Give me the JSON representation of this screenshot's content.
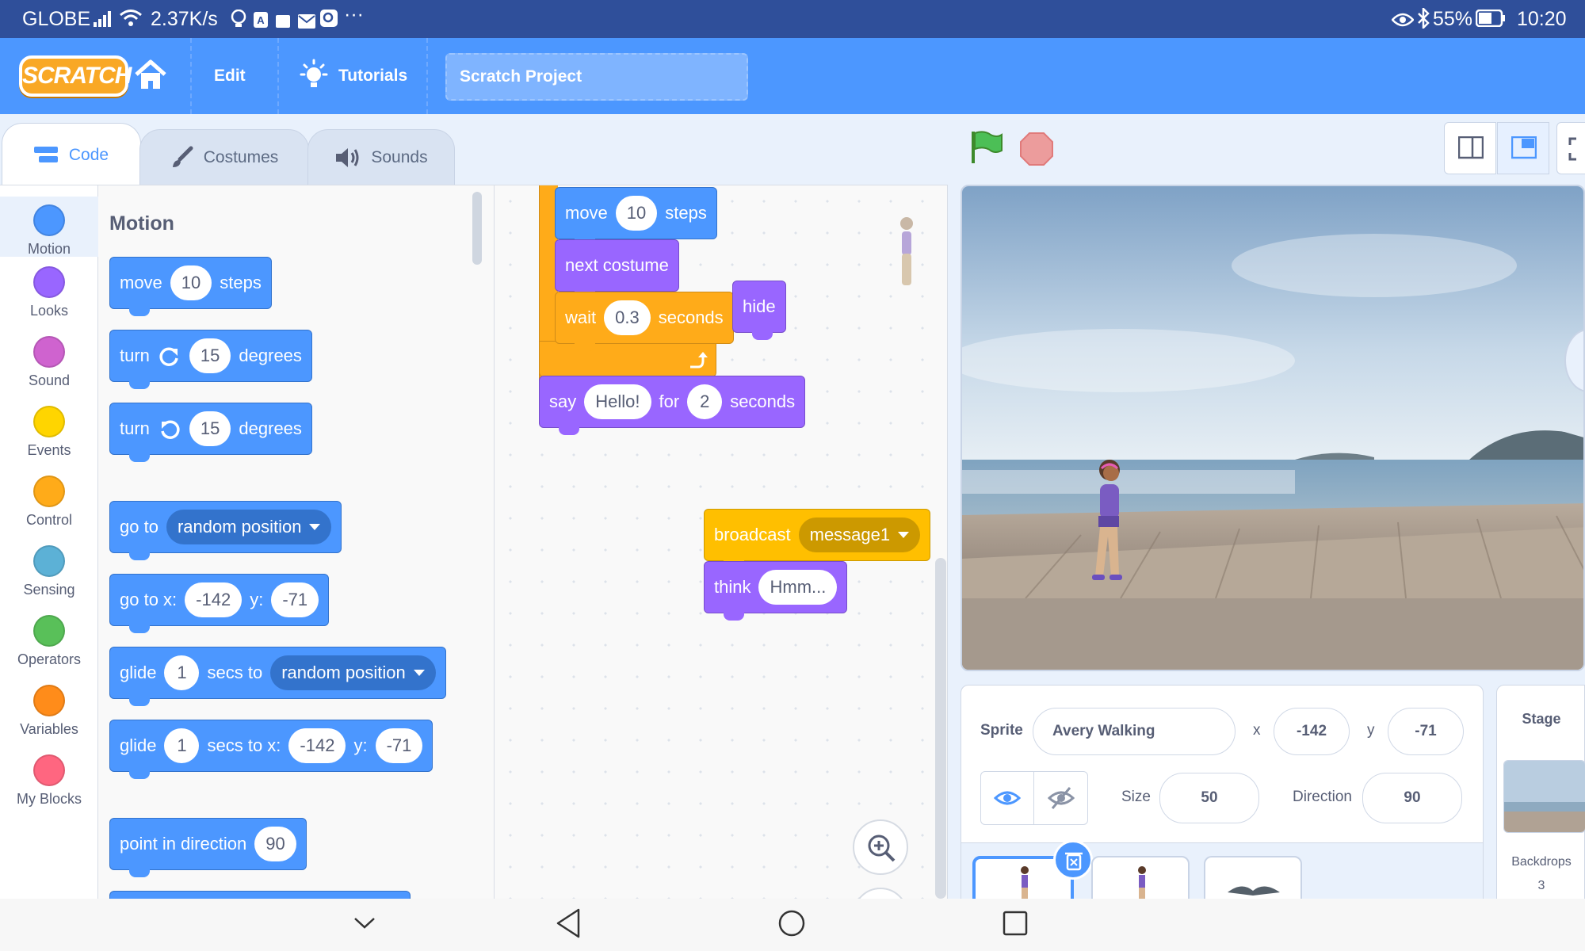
{
  "status_bar": {
    "carrier": "GLOBE",
    "net_speed": "2.37K/s",
    "battery": "55%",
    "time": "10:20"
  },
  "menu": {
    "logo": "SCRATCH",
    "edit": "Edit",
    "tutorials": "Tutorials",
    "project_title": "Scratch Project"
  },
  "tabs": {
    "code": "Code",
    "costumes": "Costumes",
    "sounds": "Sounds"
  },
  "categories": [
    {
      "label": "Motion",
      "color": "#4c97ff"
    },
    {
      "label": "Looks",
      "color": "#9966ff"
    },
    {
      "label": "Sound",
      "color": "#cf63cf"
    },
    {
      "label": "Events",
      "color": "#ffd500"
    },
    {
      "label": "Control",
      "color": "#ffab19"
    },
    {
      "label": "Sensing",
      "color": "#5cb1d6"
    },
    {
      "label": "Operators",
      "color": "#59c059"
    },
    {
      "label": "Variables",
      "color": "#ff8c1a"
    },
    {
      "label": "My Blocks",
      "color": "#ff6680"
    }
  ],
  "palette": {
    "heading": "Motion",
    "move": {
      "a": "move",
      "n": "10",
      "b": "steps"
    },
    "turn_right": {
      "a": "turn",
      "n": "15",
      "b": "degrees"
    },
    "turn_left": {
      "a": "turn",
      "n": "15",
      "b": "degrees"
    },
    "goto": {
      "a": "go to",
      "opt": "random position"
    },
    "goto_xy": {
      "a": "go to x:",
      "x": "-142",
      "y_lbl": "y:",
      "y": "-71"
    },
    "glide": {
      "a": "glide",
      "n": "1",
      "b": "secs to",
      "opt": "random position"
    },
    "glide_xy": {
      "a": "glide",
      "n": "1",
      "b": "secs to x:",
      "x": "-142",
      "y_lbl": "y:",
      "y": "-71"
    },
    "point": {
      "a": "point in direction",
      "n": "90"
    }
  },
  "script": {
    "move": {
      "a": "move",
      "n": "10",
      "b": "steps"
    },
    "next_costume": "next costume",
    "wait": {
      "a": "wait",
      "n": "0.3",
      "b": "seconds"
    },
    "hide": "hide",
    "say": {
      "a": "say",
      "msg": "Hello!",
      "for": "for",
      "n": "2",
      "b": "seconds"
    },
    "broadcast": {
      "a": "broadcast",
      "opt": "message1"
    },
    "think": {
      "a": "think",
      "msg": "Hmm..."
    }
  },
  "sprite_info": {
    "sprite_label": "Sprite",
    "sprite_name": "Avery Walking",
    "x_label": "x",
    "x": "-142",
    "y_label": "y",
    "y": "-71",
    "size_label": "Size",
    "size": "50",
    "direction_label": "Direction",
    "direction": "90"
  },
  "stage_panel": {
    "title": "Stage",
    "backdrops_label": "Backdrops",
    "backdrops_count": "3"
  }
}
